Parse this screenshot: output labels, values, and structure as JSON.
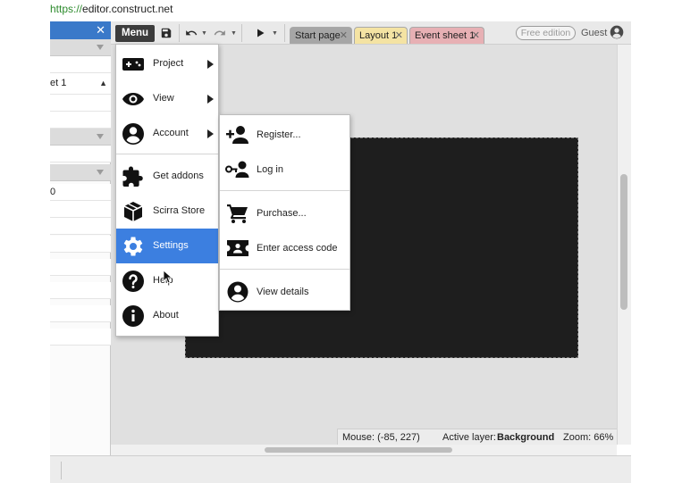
{
  "browser": {
    "url_scheme": "https://",
    "url_rest": "editor.construct.net"
  },
  "left_panel": {
    "select_value": "et 1",
    "number_value": "0"
  },
  "toolbar": {
    "menu_label": "Menu",
    "free_edition_label": "Free edition",
    "guest_label": "Guest"
  },
  "tabs": [
    {
      "label": "Start page",
      "color": "#a6a6a6"
    },
    {
      "label": "Layout 1",
      "color": "#f4e3a3"
    },
    {
      "label": "Event sheet 1",
      "color": "#e7b0b4"
    }
  ],
  "main_menu": {
    "items": [
      {
        "label": "Project",
        "icon": "gamepad-icon",
        "has_submenu": true
      },
      {
        "label": "View",
        "icon": "eye-icon",
        "has_submenu": true
      },
      {
        "label": "Account",
        "icon": "account-circle-icon",
        "has_submenu": true
      },
      {
        "label": "Get addons",
        "icon": "puzzle-icon",
        "has_submenu": false
      },
      {
        "label": "Scirra Store",
        "icon": "box-icon",
        "has_submenu": false
      },
      {
        "label": "Settings",
        "icon": "gear-icon",
        "has_submenu": false,
        "active": true
      },
      {
        "label": "Help",
        "icon": "help-icon",
        "has_submenu": false
      },
      {
        "label": "About",
        "icon": "info-icon",
        "has_submenu": false
      }
    ],
    "active_color": "#3c7fe0"
  },
  "account_submenu": {
    "items": [
      {
        "label": "Register...",
        "icon": "add-user-icon"
      },
      {
        "label": "Log in",
        "icon": "key-user-icon"
      },
      {
        "label": "Purchase...",
        "icon": "cart-icon"
      },
      {
        "label": "Enter access code",
        "icon": "ticket-icon"
      },
      {
        "label": "View details",
        "icon": "account-circle-icon"
      }
    ]
  },
  "status_bar": {
    "mouse": "Mouse: (-85, 227)",
    "active_layer_label": "Active layer:",
    "active_layer_value": "Background",
    "zoom": "Zoom: 66%"
  }
}
